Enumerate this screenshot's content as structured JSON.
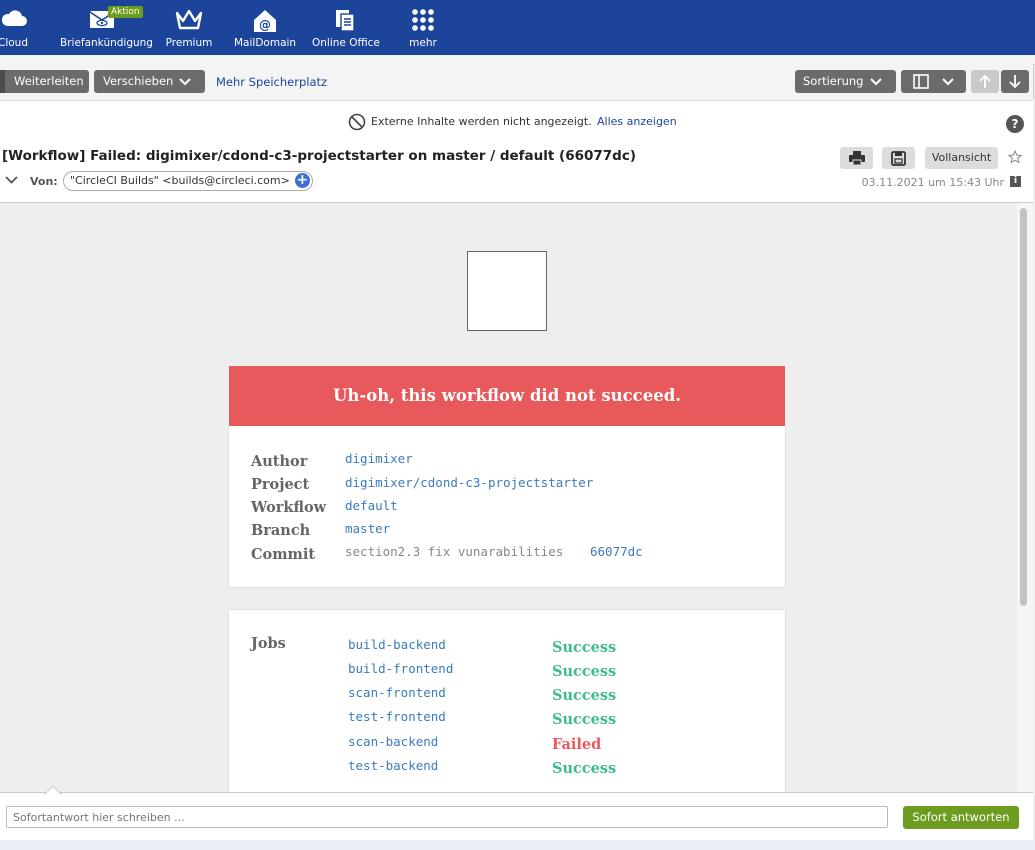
{
  "topnav": {
    "items": [
      {
        "label": "Cloud",
        "icon": "cloud-icon"
      },
      {
        "label": "Briefankündigung",
        "icon": "letter-icon",
        "badge": "Aktion"
      },
      {
        "label": "Premium",
        "icon": "crown-icon"
      },
      {
        "label": "MailDomain",
        "icon": "maildomain-house-icon"
      },
      {
        "label": "Online Office",
        "icon": "documents-icon"
      },
      {
        "label": "mehr",
        "icon": "grid-dots-icon"
      }
    ]
  },
  "toolbar": {
    "forward_label": "Weiterleiten",
    "move_label": "Verschieben",
    "more_storage_label": "Mehr Speicherplatz",
    "sort_label": "Sortierung"
  },
  "external_content": {
    "notice": "Externe Inhalte werden nicht angezeigt.",
    "show_all_label": "Alles anzeigen",
    "help_label": "?"
  },
  "header": {
    "subject": "[Workflow] Failed: digimixer/cdond-c3-projectstarter on master / default (66077dc)",
    "fullview_label": "Vollansicht",
    "from_label": "Von:",
    "from_value": "\"CircleCI Builds\" <builds@circleci.com>",
    "date": "03.11.2021 um 15:43 Uhr"
  },
  "email": {
    "banner": "Uh-oh, this workflow did not succeed.",
    "details": [
      {
        "label": "Author",
        "value": "digimixer"
      },
      {
        "label": "Project",
        "value": "digimixer/cdond-c3-projectstarter"
      },
      {
        "label": "Workflow",
        "value": "default"
      },
      {
        "label": "Branch",
        "value": "master"
      },
      {
        "label": "Commit",
        "message": "section2.3 fix vunarabilities",
        "value": "66077dc"
      }
    ],
    "jobs_label": "Jobs",
    "jobs": [
      {
        "name": "build-backend",
        "status": "Success"
      },
      {
        "name": "build-frontend",
        "status": "Success"
      },
      {
        "name": "scan-frontend",
        "status": "Success"
      },
      {
        "name": "test-frontend",
        "status": "Success"
      },
      {
        "name": "scan-backend",
        "status": "Failed"
      },
      {
        "name": "test-backend",
        "status": "Success"
      }
    ]
  },
  "reply": {
    "placeholder": "Sofortantwort hier schreiben ...",
    "send_label": "Sofort antworten"
  },
  "colors": {
    "brand_blue": "#1c449b",
    "banner_red": "#e8595c",
    "success_green": "#3ebd8b",
    "reply_green": "#6d9d1e"
  }
}
